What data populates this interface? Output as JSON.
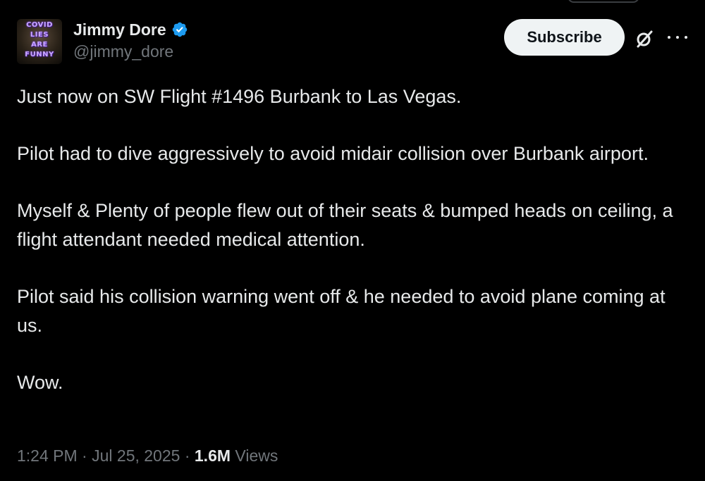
{
  "author": {
    "display_name": "Jimmy Dore",
    "handle": "@jimmy_dore",
    "verified": true,
    "verified_color": "#1d9bf0",
    "avatar_text": [
      "COVID",
      "LIES",
      "ARE",
      "FUNNY"
    ]
  },
  "actions": {
    "subscribe_label": "Subscribe",
    "grok_icon": "grok-icon",
    "more_icon": "more-icon"
  },
  "tweet": {
    "paragraphs": [
      "Just now on SW Flight #1496 Burbank to Las Vegas.",
      "Pilot had to dive aggressively to avoid midair collision over Burbank airport.",
      "Myself & Plenty of people flew out of their seats & bumped heads on ceiling, a flight attendant needed medical attention.",
      "Pilot said his collision warning went off & he needed to avoid plane coming at us.",
      "Wow."
    ]
  },
  "meta": {
    "time": "1:24 PM",
    "separator": " · ",
    "date": "Jul 25, 2025",
    "views_count": "1.6M",
    "views_label": "Views"
  },
  "colors": {
    "background": "#000000",
    "text_primary": "#e7e9ea",
    "text_secondary": "#71767b",
    "button_bg": "#eff3f4"
  }
}
